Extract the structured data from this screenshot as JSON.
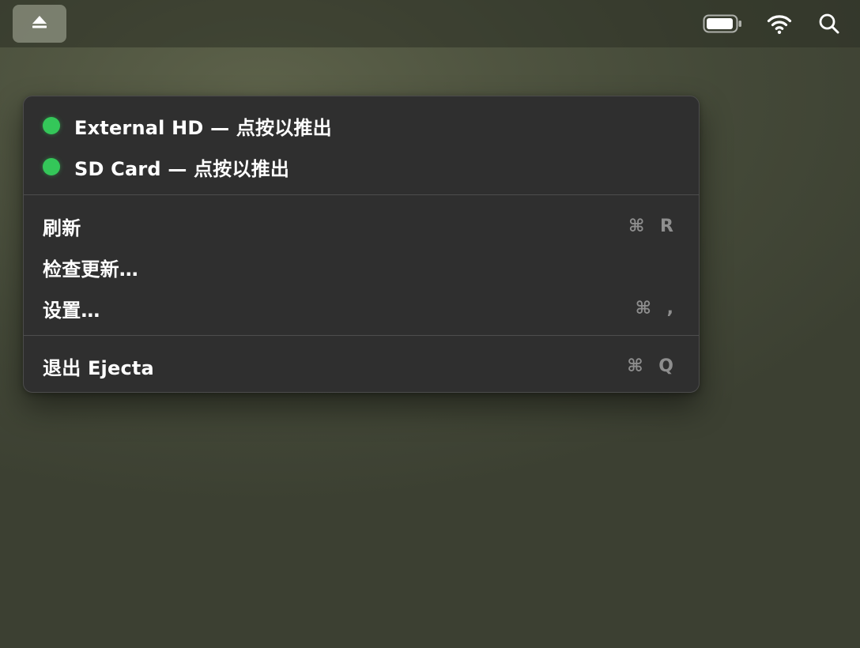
{
  "menubar": {
    "app_icon": "eject-icon",
    "status_icons": [
      "battery-icon",
      "wifi-icon",
      "search-icon"
    ]
  },
  "menu": {
    "disks": [
      {
        "label": "External HD — 点按以推出",
        "status_color": "#34c759"
      },
      {
        "label": "SD Card — 点按以推出",
        "status_color": "#34c759"
      }
    ],
    "actions": [
      {
        "label": "刷新",
        "shortcut": "⌘ R"
      },
      {
        "label": "检查更新…",
        "shortcut": ""
      },
      {
        "label": "设置…",
        "shortcut": "⌘ ,"
      }
    ],
    "quit": {
      "label": "退出 Ejecta",
      "shortcut": "⌘ Q"
    }
  },
  "colors": {
    "menu_background": "#2f2f2f",
    "status_green": "#34c759",
    "shortcut_gray": "#8e8e8e"
  }
}
